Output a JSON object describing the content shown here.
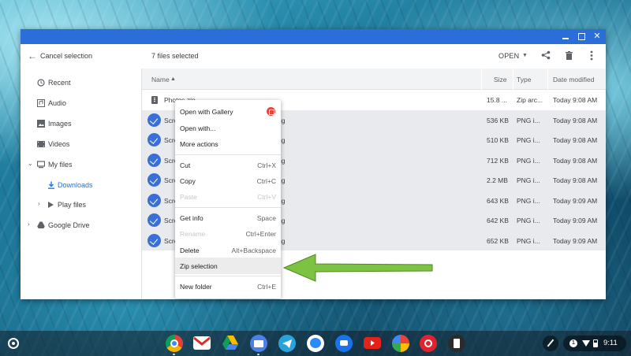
{
  "window": {
    "toolbar": {
      "cancel_label": "Cancel selection",
      "selected_label": "7 files selected",
      "open_label": "OPEN"
    }
  },
  "sidebar": {
    "items": [
      {
        "label": "Recent",
        "icon": "clock-icon"
      },
      {
        "label": "Audio",
        "icon": "audio-icon"
      },
      {
        "label": "Images",
        "icon": "image-icon"
      },
      {
        "label": "Videos",
        "icon": "video-icon"
      },
      {
        "label": "My files",
        "icon": "computer-icon"
      },
      {
        "label": "Downloads",
        "icon": "download-icon"
      },
      {
        "label": "Play files",
        "icon": "play-files-icon"
      },
      {
        "label": "Google Drive",
        "icon": "drive-icon"
      }
    ]
  },
  "filelist": {
    "columns": {
      "name": "Name",
      "size": "Size",
      "type": "Type",
      "date": "Date modified"
    },
    "rows": [
      {
        "name": "Photos.zip",
        "size": "15.8 ...",
        "type": "Zip arc...",
        "date": "Today 9:08 AM",
        "selected": false
      },
      {
        "name": "Scre",
        "tail": "ng",
        "size": "536 KB",
        "type": "PNG i...",
        "date": "Today 9:08 AM",
        "selected": true
      },
      {
        "name": "Scre",
        "tail": "ng",
        "size": "510 KB",
        "type": "PNG i...",
        "date": "Today 9:08 AM",
        "selected": true
      },
      {
        "name": "Scre",
        "tail": "ng",
        "size": "712 KB",
        "type": "PNG i...",
        "date": "Today 9:08 AM",
        "selected": true
      },
      {
        "name": "Scre",
        "tail": "ng",
        "size": "2.2 MB",
        "type": "PNG i...",
        "date": "Today 9:08 AM",
        "selected": true
      },
      {
        "name": "Scre",
        "tail": "ng",
        "size": "643 KB",
        "type": "PNG i...",
        "date": "Today 9:09 AM",
        "selected": true
      },
      {
        "name": "Scre",
        "tail": "ng",
        "size": "642 KB",
        "type": "PNG i...",
        "date": "Today 9:09 AM",
        "selected": true
      },
      {
        "name": "Scre",
        "tail": "ng",
        "size": "652 KB",
        "type": "PNG i...",
        "date": "Today 9:09 AM",
        "selected": true
      }
    ]
  },
  "context_menu": {
    "items": [
      {
        "label": "Open with Gallery",
        "shortcut": ""
      },
      {
        "label": "Open with...",
        "shortcut": ""
      },
      {
        "label": "More actions",
        "shortcut": ""
      },
      {
        "label": "Cut",
        "shortcut": "Ctrl+X"
      },
      {
        "label": "Copy",
        "shortcut": "Ctrl+C"
      },
      {
        "label": "Paste",
        "shortcut": "Ctrl+V",
        "disabled": true
      },
      {
        "label": "Get info",
        "shortcut": "Space"
      },
      {
        "label": "Rename",
        "shortcut": "Ctrl+Enter",
        "disabled": true
      },
      {
        "label": "Delete",
        "shortcut": "Alt+Backspace"
      },
      {
        "label": "Zip selection",
        "shortcut": "",
        "highlighted": true
      },
      {
        "label": "New folder",
        "shortcut": "Ctrl+E"
      }
    ]
  },
  "shelf": {
    "apps": [
      "chrome-icon",
      "gmail-icon",
      "drive-icon",
      "files-icon",
      "telegram-icon",
      "messenger-icon",
      "messages-icon",
      "youtube-icon",
      "photos-icon",
      "adobe-icon",
      "chromebook-app-icon"
    ],
    "notification_count": "1",
    "time": "9:11"
  },
  "colors": {
    "titlebar": "#2c6ed9",
    "selection_check": "#3a6fd8",
    "arrow_green": "#7dc242"
  }
}
